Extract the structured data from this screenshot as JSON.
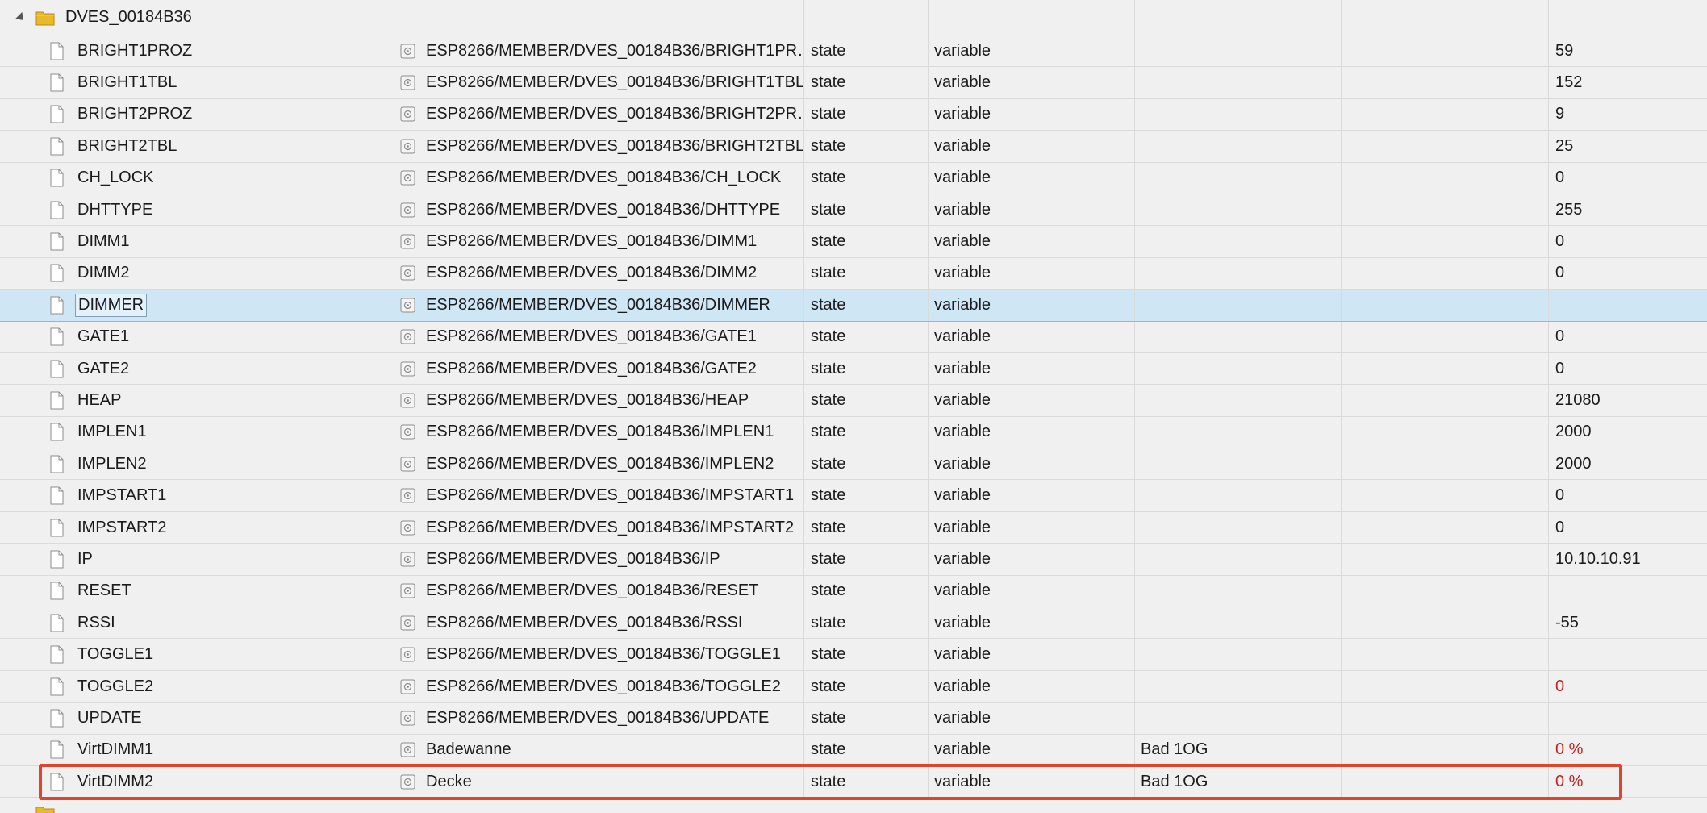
{
  "folder": {
    "name": "DVES_00184B36"
  },
  "rows": [
    {
      "name": "BRIGHT1PROZ",
      "id": "ESP8266/MEMBER/DVES_00184B36/BRIGHT1PR…",
      "type": "state",
      "vtype": "variable",
      "room": "",
      "value": "59",
      "value_red": false
    },
    {
      "name": "BRIGHT1TBL",
      "id": "ESP8266/MEMBER/DVES_00184B36/BRIGHT1TBL",
      "type": "state",
      "vtype": "variable",
      "room": "",
      "value": "152",
      "value_red": false
    },
    {
      "name": "BRIGHT2PROZ",
      "id": "ESP8266/MEMBER/DVES_00184B36/BRIGHT2PR…",
      "type": "state",
      "vtype": "variable",
      "room": "",
      "value": "9",
      "value_red": false
    },
    {
      "name": "BRIGHT2TBL",
      "id": "ESP8266/MEMBER/DVES_00184B36/BRIGHT2TBL",
      "type": "state",
      "vtype": "variable",
      "room": "",
      "value": "25",
      "value_red": false
    },
    {
      "name": "CH_LOCK",
      "id": "ESP8266/MEMBER/DVES_00184B36/CH_LOCK",
      "type": "state",
      "vtype": "variable",
      "room": "",
      "value": "0",
      "value_red": false
    },
    {
      "name": "DHTTYPE",
      "id": "ESP8266/MEMBER/DVES_00184B36/DHTTYPE",
      "type": "state",
      "vtype": "variable",
      "room": "",
      "value": "255",
      "value_red": false
    },
    {
      "name": "DIMM1",
      "id": "ESP8266/MEMBER/DVES_00184B36/DIMM1",
      "type": "state",
      "vtype": "variable",
      "room": "",
      "value": "0",
      "value_red": false
    },
    {
      "name": "DIMM2",
      "id": "ESP8266/MEMBER/DVES_00184B36/DIMM2",
      "type": "state",
      "vtype": "variable",
      "room": "",
      "value": "0",
      "value_red": false
    },
    {
      "name": "DIMMER",
      "id": "ESP8266/MEMBER/DVES_00184B36/DIMMER",
      "type": "state",
      "vtype": "variable",
      "room": "",
      "value": "",
      "value_red": false
    },
    {
      "name": "GATE1",
      "id": "ESP8266/MEMBER/DVES_00184B36/GATE1",
      "type": "state",
      "vtype": "variable",
      "room": "",
      "value": "0",
      "value_red": false
    },
    {
      "name": "GATE2",
      "id": "ESP8266/MEMBER/DVES_00184B36/GATE2",
      "type": "state",
      "vtype": "variable",
      "room": "",
      "value": "0",
      "value_red": false
    },
    {
      "name": "HEAP",
      "id": "ESP8266/MEMBER/DVES_00184B36/HEAP",
      "type": "state",
      "vtype": "variable",
      "room": "",
      "value": "21080",
      "value_red": false
    },
    {
      "name": "IMPLEN1",
      "id": "ESP8266/MEMBER/DVES_00184B36/IMPLEN1",
      "type": "state",
      "vtype": "variable",
      "room": "",
      "value": "2000",
      "value_red": false
    },
    {
      "name": "IMPLEN2",
      "id": "ESP8266/MEMBER/DVES_00184B36/IMPLEN2",
      "type": "state",
      "vtype": "variable",
      "room": "",
      "value": "2000",
      "value_red": false
    },
    {
      "name": "IMPSTART1",
      "id": "ESP8266/MEMBER/DVES_00184B36/IMPSTART1",
      "type": "state",
      "vtype": "variable",
      "room": "",
      "value": "0",
      "value_red": false
    },
    {
      "name": "IMPSTART2",
      "id": "ESP8266/MEMBER/DVES_00184B36/IMPSTART2",
      "type": "state",
      "vtype": "variable",
      "room": "",
      "value": "0",
      "value_red": false
    },
    {
      "name": "IP",
      "id": "ESP8266/MEMBER/DVES_00184B36/IP",
      "type": "state",
      "vtype": "variable",
      "room": "",
      "value": "10.10.10.91",
      "value_red": false
    },
    {
      "name": "RESET",
      "id": "ESP8266/MEMBER/DVES_00184B36/RESET",
      "type": "state",
      "vtype": "variable",
      "room": "",
      "value": "",
      "value_red": false
    },
    {
      "name": "RSSI",
      "id": "ESP8266/MEMBER/DVES_00184B36/RSSI",
      "type": "state",
      "vtype": "variable",
      "room": "",
      "value": "-55",
      "value_red": false
    },
    {
      "name": "TOGGLE1",
      "id": "ESP8266/MEMBER/DVES_00184B36/TOGGLE1",
      "type": "state",
      "vtype": "variable",
      "room": "",
      "value": "",
      "value_red": false
    },
    {
      "name": "TOGGLE2",
      "id": "ESP8266/MEMBER/DVES_00184B36/TOGGLE2",
      "type": "state",
      "vtype": "variable",
      "room": "",
      "value": "0",
      "value_red": true
    },
    {
      "name": "UPDATE",
      "id": "ESP8266/MEMBER/DVES_00184B36/UPDATE",
      "type": "state",
      "vtype": "variable",
      "room": "",
      "value": "",
      "value_red": false
    },
    {
      "name": "VirtDIMM1",
      "id": "Badewanne",
      "type": "state",
      "vtype": "variable",
      "room": "Bad 1OG",
      "value": "0 %",
      "value_red": true
    },
    {
      "name": "VirtDIMM2",
      "id": "Decke",
      "type": "state",
      "vtype": "variable",
      "room": "Bad 1OG",
      "value": "0 %",
      "value_red": true
    }
  ],
  "selected_row": "DIMMER",
  "highlighted_row": "VirtDIMM2",
  "colors": {
    "selection": "#cfe7f5",
    "highlight_border": "#e0452b",
    "value_red": "#c81e1e"
  }
}
